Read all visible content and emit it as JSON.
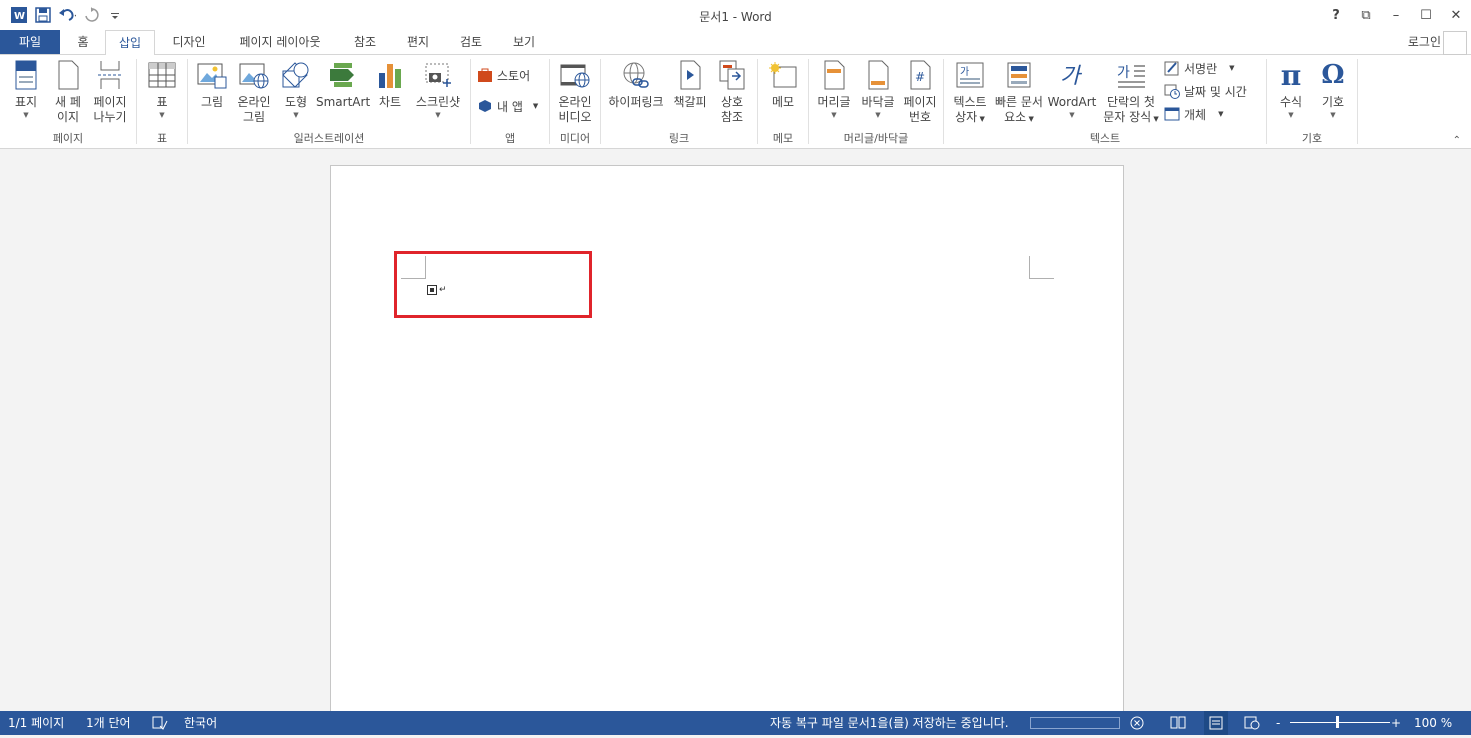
{
  "window": {
    "title": "문서1 - Word"
  },
  "quick_access": [
    {
      "name": "word-logo-icon"
    },
    {
      "name": "save-icon"
    },
    {
      "name": "undo-icon"
    },
    {
      "name": "redo-icon"
    },
    {
      "name": "customize-icon"
    }
  ],
  "window_controls": {
    "help": "?",
    "ribbon_options": "⧉",
    "minimize": "–",
    "maximize": "☐",
    "close": "✕"
  },
  "tabs": {
    "file": "파일",
    "home": "홈",
    "insert": "삽입",
    "design": "디자인",
    "layout": "페이지 레이아웃",
    "references": "참조",
    "mailings": "편지",
    "review": "검토",
    "view": "보기"
  },
  "account": {
    "login": "로그인"
  },
  "ribbon": {
    "pages": {
      "label": "페이지",
      "cover": "표지",
      "blank1": "새 페",
      "blank2": "이지",
      "break1": "페이지",
      "break2": "나누기"
    },
    "tables": {
      "label": "표",
      "table": "표"
    },
    "illustrations": {
      "label": "일러스트레이션",
      "picture": "그림",
      "online1": "온라인",
      "online2": "그림",
      "shapes": "도형",
      "smartart": "SmartArt",
      "chart": "차트",
      "screenshot": "스크린샷"
    },
    "apps": {
      "label": "앱",
      "store": "스토어",
      "myapps": "내 앱"
    },
    "media": {
      "label": "미디어",
      "video1": "온라인",
      "video2": "비디오"
    },
    "links": {
      "label": "링크",
      "hyperlink": "하이퍼링크",
      "bookmark": "책갈피",
      "cross1": "상호",
      "cross2": "참조"
    },
    "comments": {
      "label": "메모",
      "comment": "메모"
    },
    "header_footer": {
      "label": "머리글/바닥글",
      "header": "머리글",
      "footer": "바닥글",
      "pagenum1": "페이지",
      "pagenum2": "번호"
    },
    "text": {
      "label": "텍스트",
      "textbox1": "텍스트",
      "textbox2": "상자",
      "quick1": "빠른 문서",
      "quick2": "요소",
      "wordart": "WordArt",
      "dropcap1": "단락의 첫",
      "dropcap2": "문자 장식",
      "signature": "서명란",
      "datetime": "날짜 및 시간",
      "object": "개체"
    },
    "symbols": {
      "label": "기호",
      "equation": "수식",
      "symbol": "기호"
    }
  },
  "statusbar": {
    "page": "1/1 페이지",
    "words": "1개 단어",
    "language": "한국어",
    "autosave": "자동 복구 파일 문서1을(를) 저장하는 중입니다.",
    "zoom": "100 %",
    "zoom_minus": "-",
    "zoom_plus": "+"
  },
  "colors": {
    "accent": "#2b579a",
    "highlight": "#e0242b"
  }
}
